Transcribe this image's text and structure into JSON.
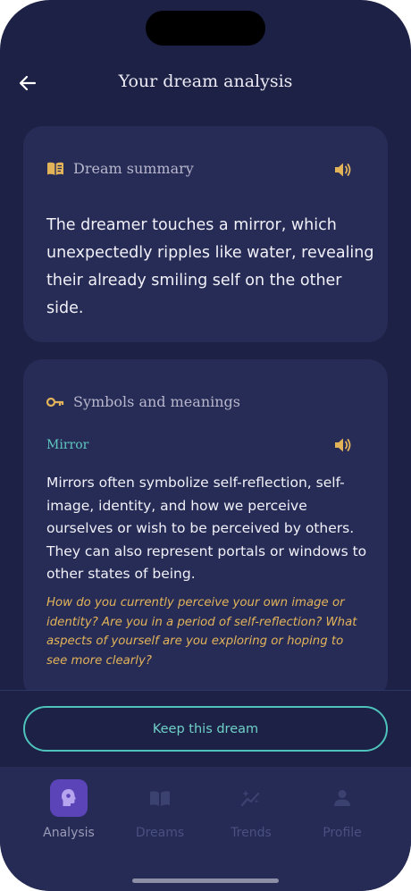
{
  "header": {
    "title": "Your dream analysis"
  },
  "summary": {
    "title": "Dream summary",
    "text": "The dreamer touches a mirror, which unexpectedly ripples like water, revealing their already smiling self on the other side."
  },
  "symbols": {
    "title": "Symbols and meanings",
    "items": [
      {
        "name": "Mirror",
        "description": "Mirrors often symbolize self-reflection, self-image, identity, and how we perceive ourselves or wish to be perceived by others. They can also represent portals or windows to other states of being.",
        "question": "How do you currently perceive your own image or identity? Are you in a period of self-reflection? What aspects of yourself are you exploring or hoping to see more clearly?"
      }
    ]
  },
  "actions": {
    "keep_label": "Keep this dream"
  },
  "tabs": [
    {
      "label": "Analysis",
      "icon": "head-icon",
      "active": true
    },
    {
      "label": "Dreams",
      "icon": "book-icon",
      "active": false
    },
    {
      "label": "Trends",
      "icon": "sparkle-chart-icon",
      "active": false
    },
    {
      "label": "Profile",
      "icon": "person-icon",
      "active": false
    }
  ],
  "colors": {
    "background": "#1c2145",
    "card": "#262c56",
    "accent_gold": "#e3b35a",
    "accent_teal": "#4ec3bc",
    "active_tab": "#5b44b8"
  }
}
